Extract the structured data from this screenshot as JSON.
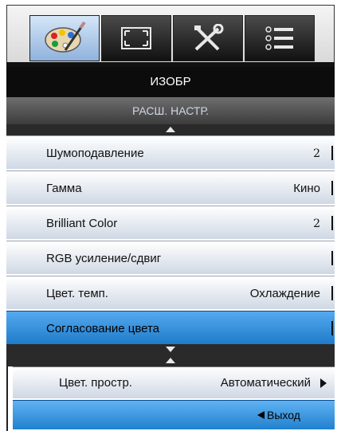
{
  "tabs": [
    {
      "icon": "palette-icon",
      "active": true
    },
    {
      "icon": "screen-resize-icon",
      "active": false
    },
    {
      "icon": "tools-icon",
      "active": false
    },
    {
      "icon": "list-icon",
      "active": false
    }
  ],
  "header": {
    "title": "ИЗОБР",
    "subtitle": "РАСШ. НАСТР."
  },
  "menu": {
    "items": [
      {
        "label": "Шумоподавление",
        "value": "2"
      },
      {
        "label": "Гамма",
        "value": "Кино"
      },
      {
        "label": "Brilliant Color",
        "value": "2"
      },
      {
        "label": "RGB усиление/сдвиг",
        "value": ""
      },
      {
        "label": "Цвет. темп.",
        "value": "Охлаждение"
      },
      {
        "label": "Согласование цвета",
        "value": ""
      }
    ],
    "selected_index": 5
  },
  "submenu": {
    "label": "Цвет. простр.",
    "value": "Автоматический"
  },
  "footer": {
    "exit_label": "Выход"
  },
  "colors": {
    "selected": "#2a8ad6",
    "header": "#0c0c0c"
  }
}
